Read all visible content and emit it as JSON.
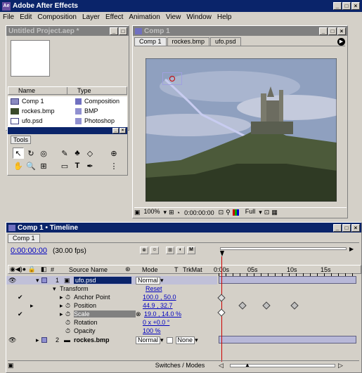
{
  "app": {
    "title": "Adobe After Effects"
  },
  "menu": [
    "File",
    "Edit",
    "Composition",
    "Layer",
    "Effect",
    "Animation",
    "View",
    "Window",
    "Help"
  ],
  "project": {
    "title": "Untitled Project.aep *",
    "col_name": "Name",
    "col_type": "Type",
    "items": [
      {
        "name": "Comp 1",
        "type": "Composition",
        "icon": "composition-icon"
      },
      {
        "name": "rockes.bmp",
        "type": "BMP",
        "icon": "image-icon"
      },
      {
        "name": "ufo.psd",
        "type": "Photoshop",
        "icon": "photoshop-icon"
      }
    ]
  },
  "tools": {
    "title": "Tools"
  },
  "comp": {
    "title": "Comp 1",
    "tabs": [
      "Comp 1",
      "rockes.bmp",
      "ufo.psd"
    ],
    "zoom": "100%",
    "time": "0:00:00:00",
    "resolution": "Full"
  },
  "timeline": {
    "title": "Comp 1 • Timeline",
    "tab": "Comp 1",
    "timecode": "0:00:00:00",
    "fps": "(30.00 fps)",
    "col_num": "#",
    "col_source": "Source Name",
    "col_mode": "Mode",
    "col_t": "T",
    "col_trkmat": "TrkMat",
    "ruler": [
      "0:00s",
      "05s",
      "10s",
      "15s"
    ],
    "layer1": {
      "num": "1",
      "name": "ufo.psd",
      "mode": "Normal"
    },
    "transform": "Transform",
    "reset": "Reset",
    "props": [
      {
        "name": "Anchor Point",
        "value": "100.0 , 50.0"
      },
      {
        "name": "Position",
        "value": "44.9 , 32.7"
      },
      {
        "name": "Scale",
        "value": "19.0 , 14.0 %"
      },
      {
        "name": "Rotation",
        "value": "0 x +0.0 °"
      },
      {
        "name": "Opacity",
        "value": "100 %"
      }
    ],
    "layer2": {
      "num": "2",
      "name": "rockes.bmp",
      "mode": "Normal",
      "trkmat": "None"
    },
    "switches": "Switches / Modes"
  }
}
